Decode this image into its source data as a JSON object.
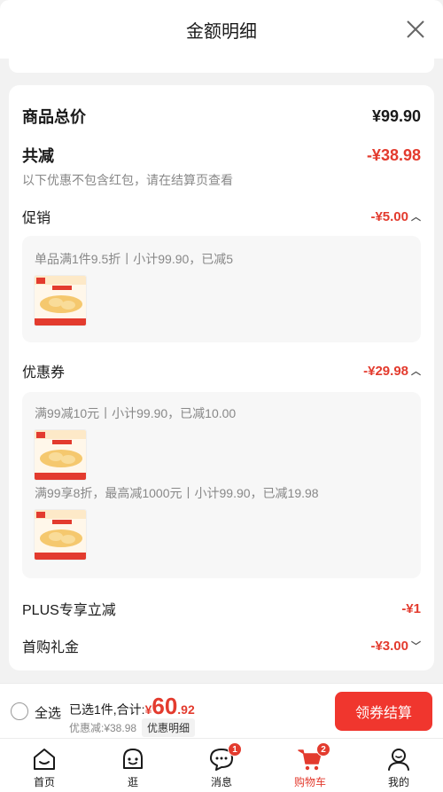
{
  "sheet": {
    "title": "金额明细"
  },
  "summary": {
    "total_label": "商品总价",
    "total_value": "¥99.90",
    "reduce_label": "共减",
    "reduce_value": "-¥38.98",
    "note": "以下优惠不包含红包，请在结算页查看"
  },
  "promotion": {
    "label": "促销",
    "value": "-¥5.00",
    "items": [
      {
        "text": "单品满1件9.5折丨小计99.90，已减5"
      }
    ]
  },
  "coupon": {
    "label": "优惠券",
    "value": "-¥29.98",
    "items": [
      {
        "text": "满99减10元丨小计99.90，已减10.00"
      },
      {
        "text": "满99享8折，最高减1000元丨小计99.90，已减19.98"
      }
    ]
  },
  "plus": {
    "label": "PLUS专享立减",
    "value": "-¥1"
  },
  "first_gift": {
    "label": "首购礼金",
    "value": "-¥3.00"
  },
  "checkout": {
    "select_all": "全选",
    "selected_text": "已选1件,合计:",
    "yen": "¥",
    "amount_int": "60",
    "amount_dec": ".92",
    "discount_text": "优惠减:¥38.98",
    "detail_button": "优惠明细",
    "checkout_button": "领券结算"
  },
  "tabs": [
    {
      "label": "首页",
      "icon": "home-icon"
    },
    {
      "label": "逛",
      "icon": "browse-face-icon"
    },
    {
      "label": "消息",
      "icon": "message-icon",
      "badge": "1"
    },
    {
      "label": "购物车",
      "icon": "cart-icon",
      "badge": "2",
      "active": true
    },
    {
      "label": "我的",
      "icon": "profile-icon"
    }
  ],
  "colors": {
    "accent": "#e33b2e",
    "button": "#f0362e",
    "background": "#f2f2f2"
  }
}
